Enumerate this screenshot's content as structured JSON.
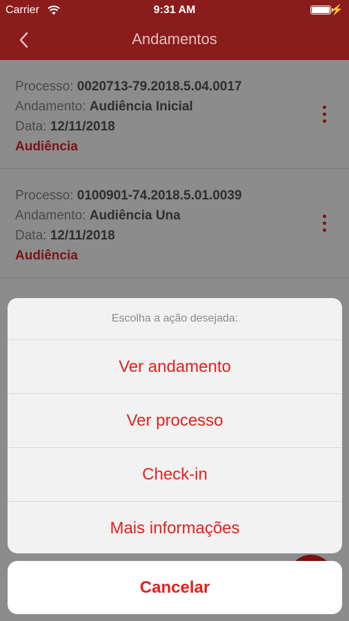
{
  "status_bar": {
    "carrier": "Carrier",
    "time": "9:31 AM",
    "wifi_icon": "wifi-icon",
    "battery_icon": "battery-icon",
    "charging_icon": "bolt-icon",
    "charging_glyph": "⚡"
  },
  "navbar": {
    "title": "Andamentos",
    "back_icon": "chevron-left-icon",
    "color": "#8a1c1c"
  },
  "list": {
    "items": [
      {
        "processo_label": "Processo:",
        "processo": "0020713-79.2018.5.04.0017",
        "andamento_label": "Andamento:",
        "andamento": "Audiência Inicial",
        "data_label": "Data:",
        "data": "12/11/2018",
        "tag": "Audiência"
      },
      {
        "processo_label": "Processo:",
        "processo": "0100901-74.2018.5.01.0039",
        "andamento_label": "Andamento:",
        "andamento": "Audiência Una",
        "data_label": "Data:",
        "data": "12/11/2018",
        "tag": "Audiência"
      }
    ],
    "menu_icon": "more-vertical-icon"
  },
  "action_sheet": {
    "header": "Escolha a ação desejada:",
    "options": [
      "Ver andamento",
      "Ver processo",
      "Check-in",
      "Mais informações"
    ],
    "cancel": "Cancelar",
    "accent": "#e3211f"
  }
}
